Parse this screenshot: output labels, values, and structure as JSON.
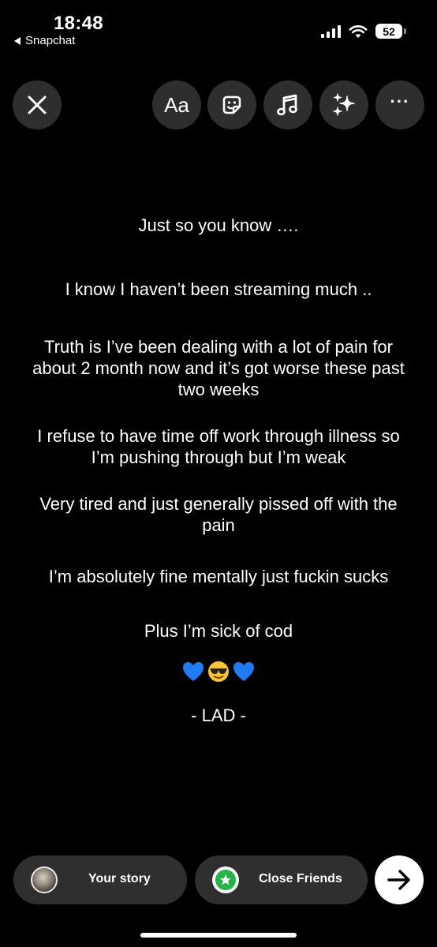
{
  "status_bar": {
    "time": "18:48",
    "back_app": "Snapchat",
    "battery": "52",
    "icons": [
      "signal-icon",
      "wifi-icon",
      "battery-icon"
    ]
  },
  "toolbar": {
    "close_icon": "close-icon",
    "text_label": "Aa",
    "sticker_icon": "sticker-icon",
    "music_icon": "music-icon",
    "effects_icon": "sparkles-icon",
    "more_label": "···"
  },
  "story": {
    "lines": [
      "Just so you know ….",
      "I know I haven’t been streaming much ..",
      "Truth is I’ve been dealing with a lot of pain for about 2 month now and it’s got worse these past two weeks",
      "I refuse to have time off work through illness so I’m pushing through but I’m weak",
      "Very tired and just generally pissed off with the pain",
      "I’m absolutely fine mentally just fuckin sucks",
      "Plus I’m sick of cod"
    ],
    "emojis": [
      "blue-heart",
      "smiling-sunglasses",
      "blue-heart"
    ],
    "signature": "- LAD -"
  },
  "bottom_bar": {
    "your_story": "Your story",
    "close_friends": "Close Friends",
    "send_icon": "arrow-right-icon"
  },
  "colors": {
    "background": "#000000",
    "button_bg": "#2e2e2e",
    "pill_bg": "#2f2f2f",
    "close_friends_green": "#25b34a",
    "heart_blue": "#1f7cf2"
  }
}
